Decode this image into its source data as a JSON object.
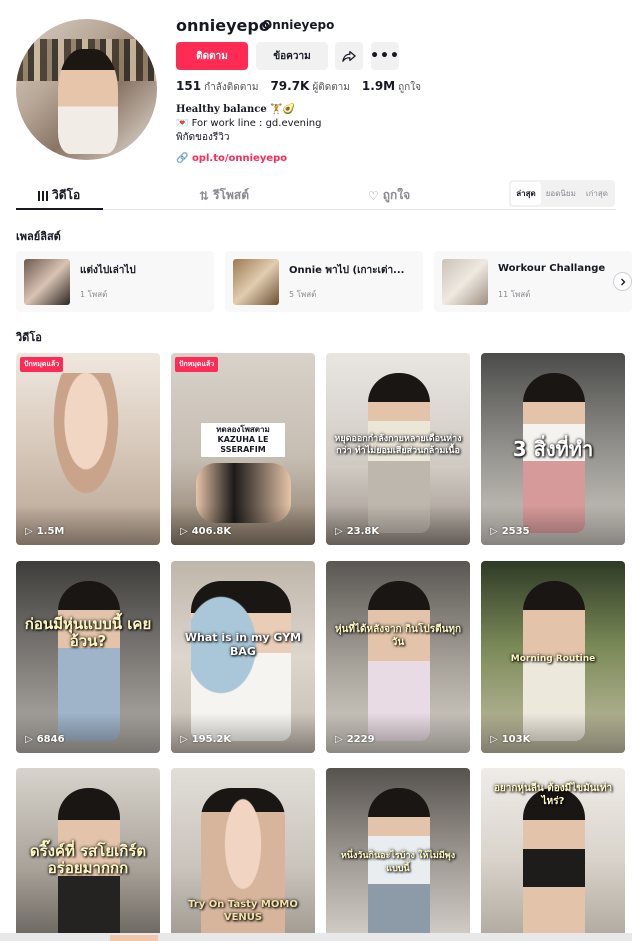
{
  "profile": {
    "username": "onnieyepo",
    "nickname": "Onnieyepo",
    "follow_label": "ติดตาม",
    "message_label": "ข้อความ",
    "stats": [
      {
        "value": "151",
        "label": "กำลังติดตาม"
      },
      {
        "value": "79.7K",
        "label": "ผู้ติดตาม"
      },
      {
        "value": "1.9M",
        "label": "ถูกใจ"
      }
    ],
    "bio": [
      "Healthy balance 🏋️🥑",
      "💌 For work line : gd.evening",
      "พิกัดของรีวิว"
    ],
    "link": "opl.to/onnieyepo"
  },
  "tabs": [
    {
      "label": "วิดีโอ",
      "icon": "grid-icon"
    },
    {
      "label": "รีโพสต์",
      "icon": "repost-icon"
    },
    {
      "label": "ถูกใจ",
      "icon": "heart-icon"
    }
  ],
  "sort": [
    "ล่าสุด",
    "ยอดนิยม",
    "เก่าสุด"
  ],
  "playlists_title": "เพลย์ลิสต์",
  "playlists": [
    {
      "name": "แต่งไปเล่าไป",
      "count": "1 โพสต์"
    },
    {
      "name": "Onnie พาไป (เกาะเต่า...",
      "count": "5 โพสต์"
    },
    {
      "name": "Workour Challange",
      "count": "11 โพสต์"
    }
  ],
  "videos_title": "วิดีโอ",
  "videos": [
    {
      "views": "1.5M",
      "badge": "ปักหมุดแล้ว",
      "caption": ""
    },
    {
      "views": "406.8K",
      "badge": "ปักหมุดแล้ว",
      "caption": "ทดลองโพสตาม KAZUHA LE SSERAFIM"
    },
    {
      "views": "23.8K",
      "badge": "",
      "caption": "หยุดออกกำลังกายหลายเดือนห่างกว่า ทำไม่ยอมเสียส่วนกล้ามเนื้อ"
    },
    {
      "views": "2535",
      "badge": "",
      "caption": "3 สิ่งที่ทำ"
    },
    {
      "views": "6846",
      "badge": "",
      "caption": "ก่อนมีหุ่นแบบนี้ เคยอ้วน?"
    },
    {
      "views": "195.2K",
      "badge": "",
      "caption": "What is in my GYM BAG"
    },
    {
      "views": "2229",
      "badge": "",
      "caption": "หุ่นที่ได้หลังจาก กินโปรตีนทุกวัน"
    },
    {
      "views": "103K",
      "badge": "",
      "caption": "Morning Routine"
    },
    {
      "views": "",
      "badge": "",
      "caption": "ดริ๊งค์ที่ รสโยเกิร์ต อร่อยมากกก"
    },
    {
      "views": "",
      "badge": "",
      "caption": "Try On Tasty MOMO VENUS"
    },
    {
      "views": "",
      "badge": "",
      "caption": "หนึ่งวันกินอะไรบ้าง ให้ไม่มีพุงแบบนี้"
    },
    {
      "views": "",
      "badge": "",
      "caption": "อยากหุ่นลีน ต้องมีไขมันเท่าไหร่?"
    }
  ],
  "colors": {
    "accent": "#fe2c55",
    "text": "#161823",
    "muted": "#8a8b91"
  }
}
